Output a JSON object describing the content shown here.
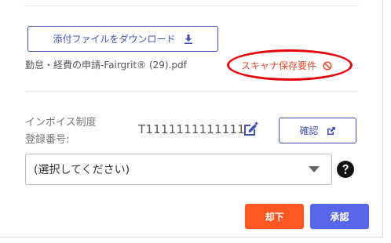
{
  "attachment": {
    "download_label": "添付ファイルをダウンロード",
    "download_icon": "download-icon",
    "filename": "勤怠・経費の申請-Fairgrit® (29).pdf",
    "scan_requirement_label": "スキャナ保存要件",
    "scan_requirement_icon": "prohibited-icon"
  },
  "invoice": {
    "label_line1": "インボイス制度",
    "label_line2": "登録番号:",
    "number": "T1111111111111",
    "edit_icon": "edit-icon",
    "confirm_label": "確認",
    "confirm_icon": "external-link-icon"
  },
  "select": {
    "value": "(選択してください)",
    "help_icon": "question-circle-icon"
  },
  "actions": {
    "reject_label": "却下",
    "approve_label": "承認"
  },
  "colors": {
    "primary": "#3f51b5",
    "reject": "#ff5722",
    "approve": "#5866ea",
    "warning_text": "#e8492b",
    "highlight_oval": "#e8000b"
  }
}
